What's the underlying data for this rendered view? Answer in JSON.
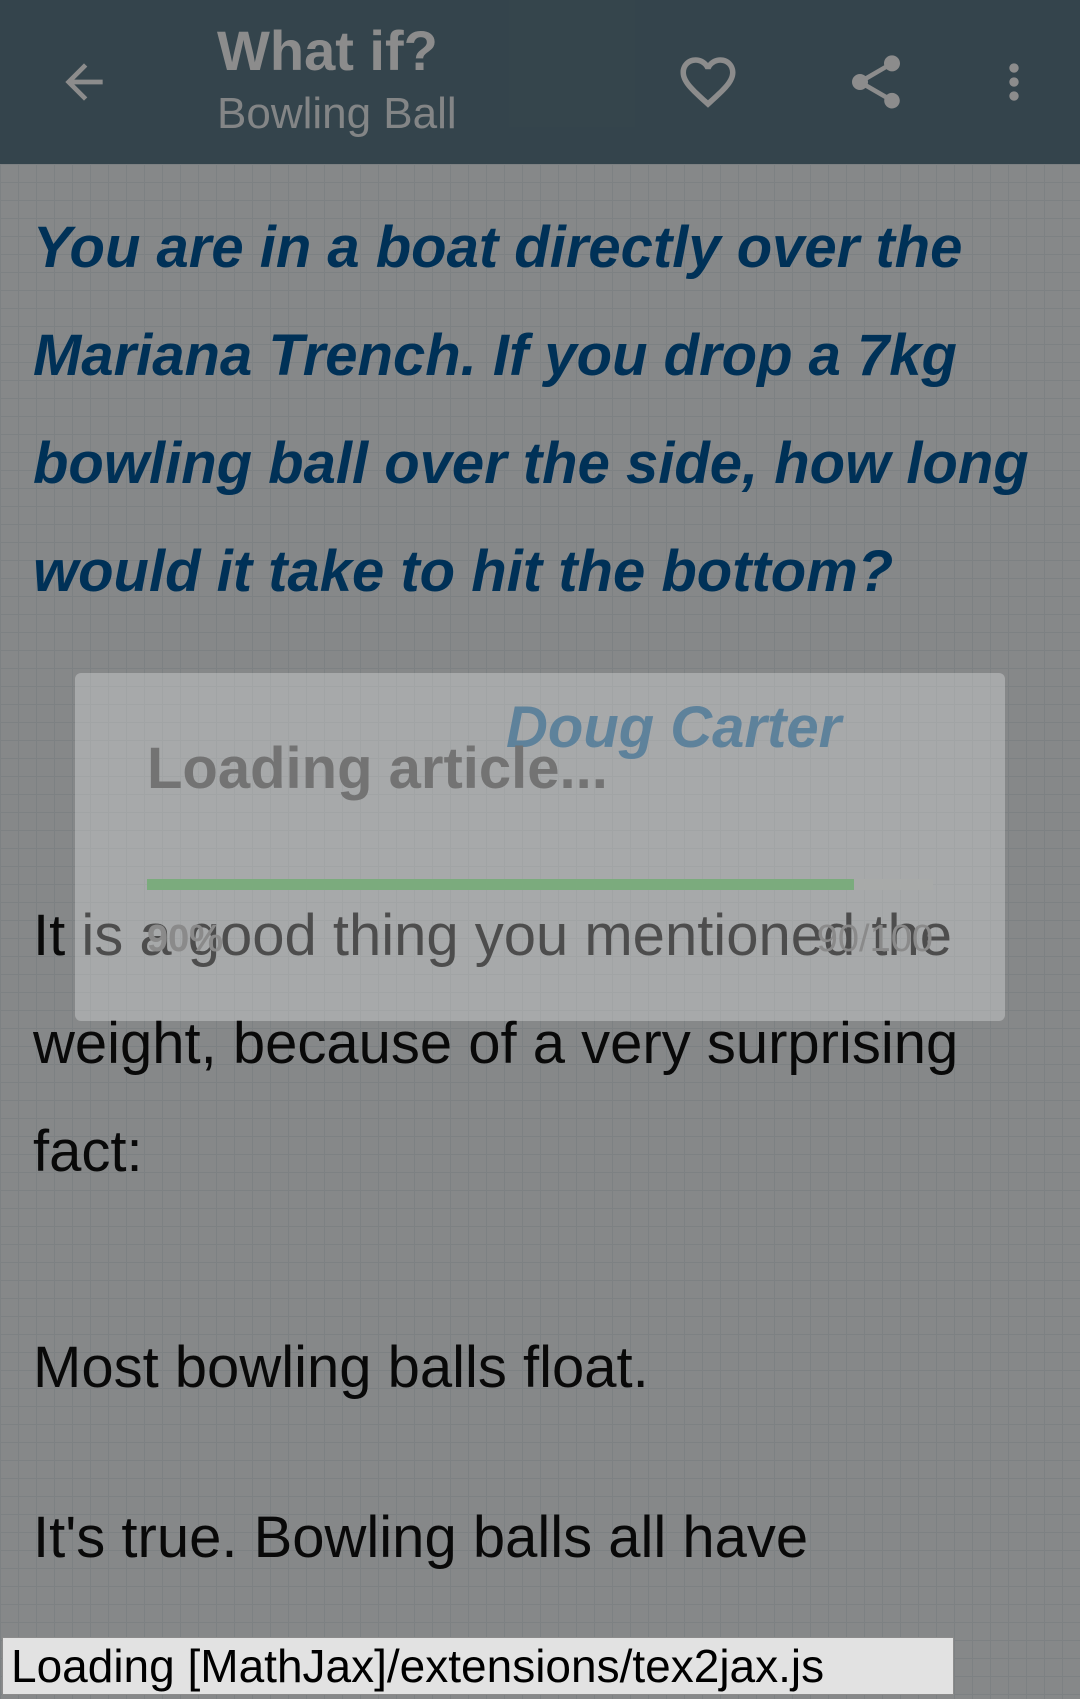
{
  "app_bar": {
    "title": "What if?",
    "subtitle": "Bowling Ball",
    "icons": [
      "back-arrow-icon",
      "heart-icon",
      "share-icon",
      "more-vert-icon"
    ]
  },
  "article": {
    "question": "You are in a boat directly over the Mariana Trench. If you drop a 7kg bowling ball over the side, how long would it take to hit the bottom?",
    "author": "Doug Carter",
    "paragraphs": [
      "It is a good thing you mentioned the weight, because of a very surprising fact:",
      "Most bowling balls float.",
      "It's true. Bowling balls all have"
    ]
  },
  "loading_dialog": {
    "message": "Loading article...",
    "progress": 0.9,
    "percent_label": "90%",
    "count_label": "90/100"
  },
  "status": {
    "mathjax_text": "Loading [MathJax]/extensions/tex2jax.js"
  },
  "colors": {
    "app_bar": "#607d8b",
    "question_text": "#005a9e",
    "author_text": "#3d95d6",
    "progress_fill": "#7bab7d"
  }
}
